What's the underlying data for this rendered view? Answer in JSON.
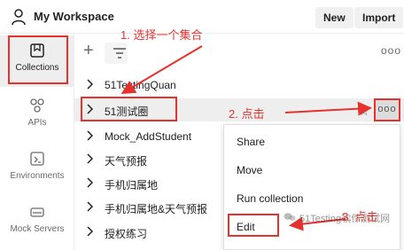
{
  "header": {
    "workspace_title": "My Workspace",
    "new_label": "New",
    "import_label": "Import"
  },
  "sidebar": {
    "items": [
      {
        "label": "Collections",
        "icon": "collections-icon",
        "active": true
      },
      {
        "label": "APIs",
        "icon": "apis-icon"
      },
      {
        "label": "Environments",
        "icon": "environments-icon"
      },
      {
        "label": "Mock Servers",
        "icon": "mock-servers-icon"
      }
    ]
  },
  "toolbar": {
    "add_symbol": "+",
    "more_symbol": "ooo"
  },
  "collections": [
    {
      "name": "51TestingQuan"
    },
    {
      "name": "51测试圈"
    },
    {
      "name": "Mock_AddStudent"
    },
    {
      "name": "天气预报"
    },
    {
      "name": "手机归属地"
    },
    {
      "name": "手机归属地&天气预报"
    },
    {
      "name": "授权练习"
    }
  ],
  "row_actions": {
    "star_symbol": "☆",
    "more_symbol": "ooo"
  },
  "context_menu": {
    "items": [
      "Share",
      "Move",
      "Run collection",
      "Edit"
    ]
  },
  "annotations": {
    "step1": "1. 选择一个集合",
    "step2": "2. 点击",
    "step3": "3. 点击"
  },
  "watermark": {
    "text": "51Testing软件测试网"
  },
  "colors": {
    "annotation_red": "#e5322d",
    "active_bg": "#eeeeee",
    "text": "#212121",
    "muted": "#6b6b6b"
  }
}
